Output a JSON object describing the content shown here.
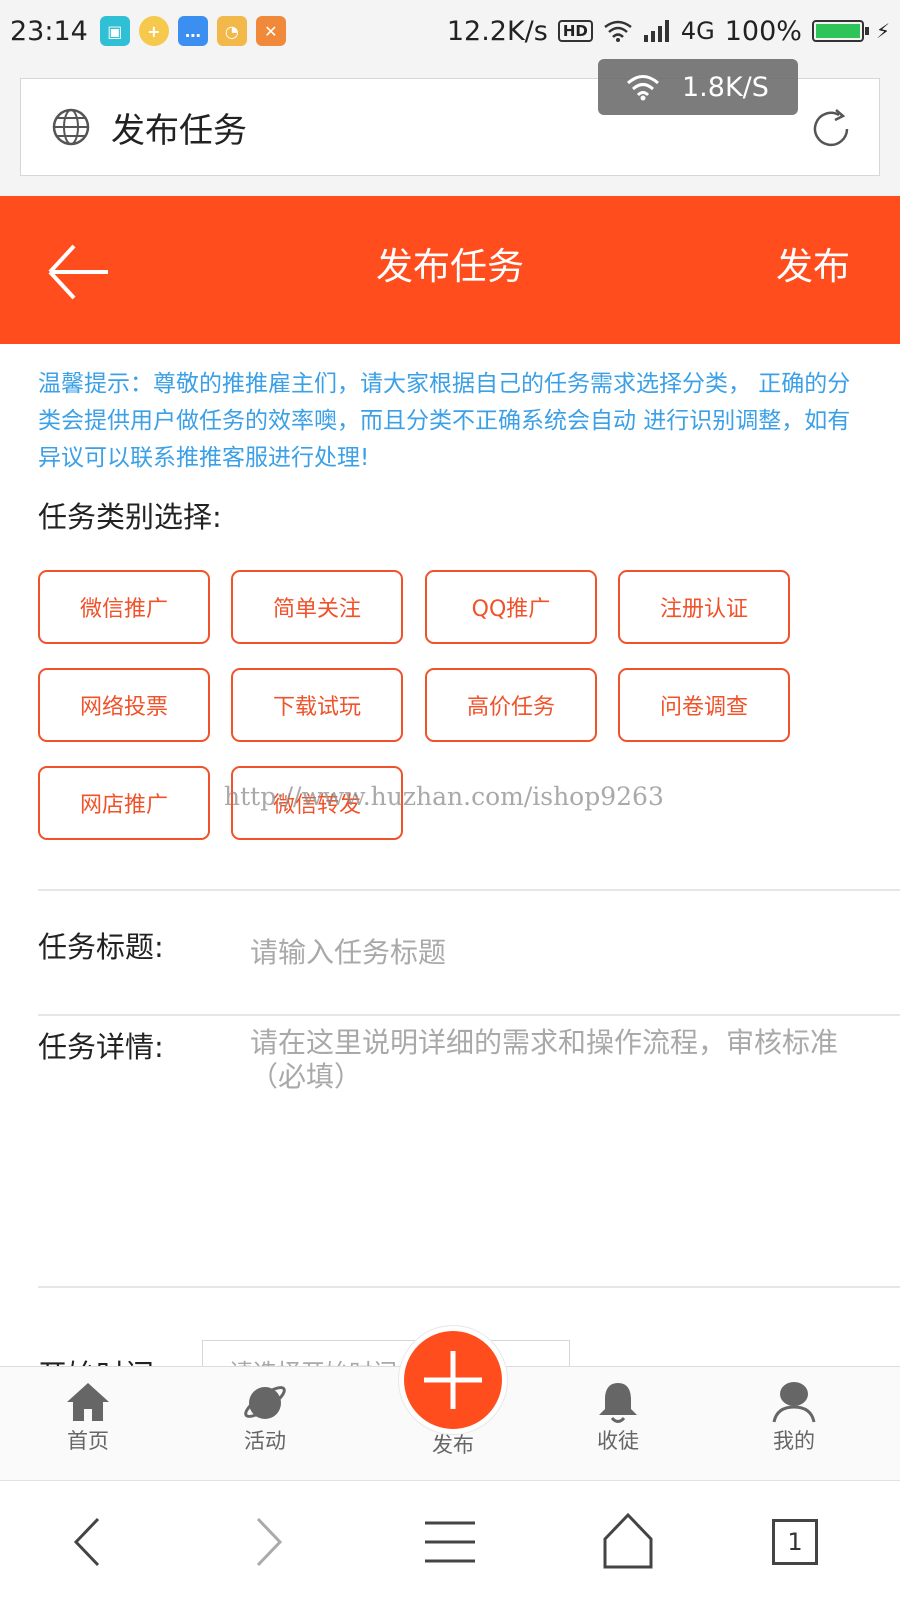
{
  "status_bar": {
    "time": "23:14",
    "net_speed": "12.2K/s",
    "hd": "HD",
    "network": "4G",
    "battery": "100%",
    "battery_level": 1.0
  },
  "browser": {
    "address_text": "发布任务",
    "toast_speed": "1.8K/S"
  },
  "header": {
    "title": "发布任务",
    "action": "发布"
  },
  "tip": "温馨提示：尊敬的推推雇主们，请大家根据自己的任务需求选择分类， 正确的分类会提供用户做任务的效率噢，而且分类不正确系统会自动 进行识别调整，如有异议可以联系推推客服进行处理!",
  "category_section": {
    "label": "任务类别选择:",
    "categories": [
      "微信推广",
      "简单关注",
      "QQ推广",
      "注册认证",
      "网络投票",
      "下载试玩",
      "高价任务",
      "问卷调查",
      "网店推广",
      "微信转发"
    ]
  },
  "watermark": "http://www.huzhan.com/ishop9263",
  "form": {
    "title_label": "任务标题:",
    "title_placeholder": "请输入任务标题",
    "detail_label": "任务详情:",
    "detail_placeholder": "请在这里说明详细的需求和操作流程，审核标准（必填）",
    "start_label": "开始时间:",
    "start_placeholder": "请选择开始时间"
  },
  "tabs": {
    "home": "首页",
    "activity": "活动",
    "publish": "发布",
    "apprentice": "收徒",
    "mine": "我的"
  },
  "sys_nav": {
    "tab_count": "1"
  },
  "colors": {
    "accent": "#ff4d1d",
    "category_border": "#f0522a",
    "tip_text": "#3ba0e6"
  }
}
